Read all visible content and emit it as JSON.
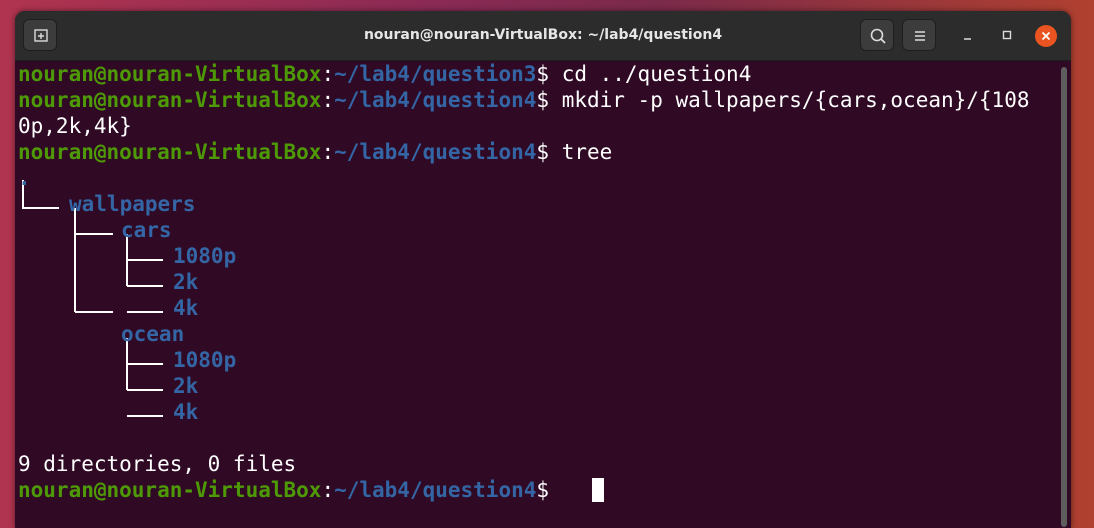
{
  "window": {
    "title": "nouran@nouran-VirtualBox: ~/lab4/question4"
  },
  "titlebar": {
    "new_tab_icon": "new-tab-icon",
    "search_icon": "search-icon",
    "menu_icon": "hamburger-menu-icon",
    "minimize_icon": "minimize-icon",
    "maximize_icon": "maximize-icon",
    "close_icon": "close-icon"
  },
  "colors": {
    "terminal_bg": "#300a24",
    "user_green": "#4e9a06",
    "path_blue": "#3465a4",
    "close_orange": "#e95420"
  },
  "terminal": {
    "lines": [
      {
        "user": "nouran@nouran-VirtualBox",
        "sep": ":",
        "path": "~/lab4/question3",
        "prompt": "$ ",
        "cmd": "cd ../question4"
      },
      {
        "user": "nouran@nouran-VirtualBox",
        "sep": ":",
        "path": "~/lab4/question4",
        "prompt": "$ ",
        "cmd": "mkdir -p wallpapers/{cars,ocean}/{108"
      },
      {
        "text": "0p,2k,4k}"
      },
      {
        "user": "nouran@nouran-VirtualBox",
        "sep": ":",
        "path": "~/lab4/question4",
        "prompt": "$ ",
        "cmd": "tree"
      },
      {
        "text": "."
      },
      {
        "text": "wallpapers"
      },
      {
        "text": "cars"
      },
      {
        "text": "1080p"
      },
      {
        "text": "2k"
      },
      {
        "text": "4k"
      },
      {
        "text": "ocean"
      },
      {
        "text": "1080p"
      },
      {
        "text": "2k"
      },
      {
        "text": "4k"
      },
      {
        "text": ""
      },
      {
        "text": "9 directories, 0 files"
      },
      {
        "user": "nouran@nouran-VirtualBox",
        "sep": ":",
        "path": "~/lab4/question4",
        "prompt": "$ ",
        "cmd": ""
      }
    ]
  }
}
